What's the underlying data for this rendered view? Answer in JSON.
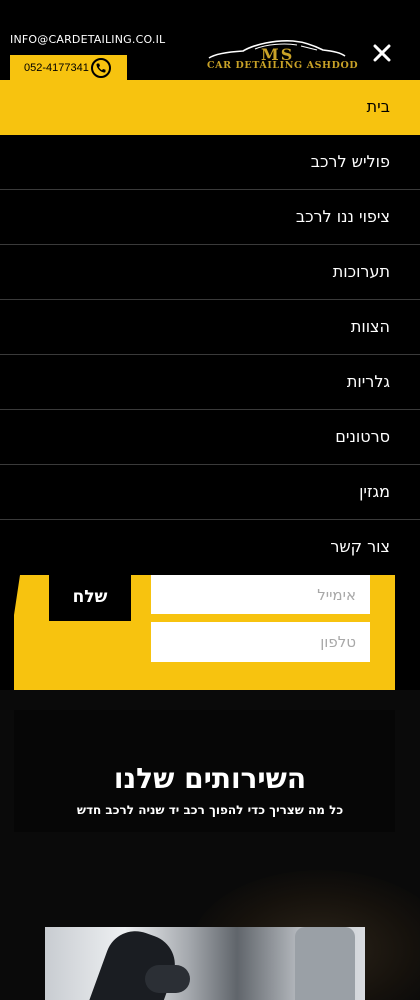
{
  "header": {
    "email": "INFO@CARDETAILING.CO.IL",
    "phone": "052-4177341",
    "logo_main": "MS",
    "logo_sub": "CAR DETAILING ASHDOD",
    "close_icon": "close-icon",
    "phone_icon": "phone-icon"
  },
  "menu": {
    "items": [
      {
        "label": "בית",
        "active": true
      },
      {
        "label": "פוליש לרכב"
      },
      {
        "label": "ציפוי ננו לרכב"
      },
      {
        "label": "תערוכות"
      },
      {
        "label": "הצוות"
      },
      {
        "label": "גלריות"
      },
      {
        "label": "סרטונים"
      },
      {
        "label": "מגזין"
      },
      {
        "label": "צור קשר"
      }
    ]
  },
  "form": {
    "send_label": "שלח",
    "email_placeholder": "אימייל",
    "phone_placeholder": "טלפון"
  },
  "services": {
    "title": "השירותים שלנו",
    "subtitle": "כל מה שצריך כדי להפוך רכב יד שניה לרכב חדש"
  },
  "colors": {
    "accent": "#f7c30f",
    "background": "#000000",
    "logo_gold": "#c9a227"
  }
}
